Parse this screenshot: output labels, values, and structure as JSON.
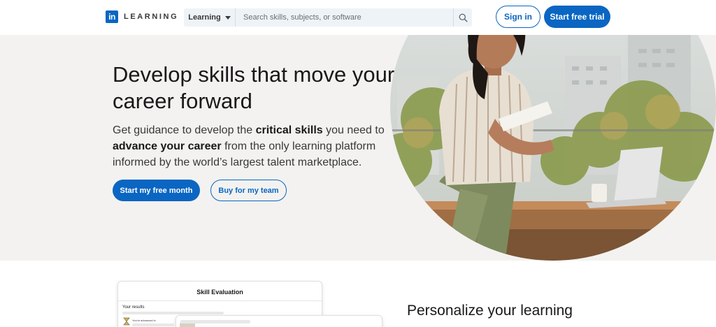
{
  "header": {
    "logo_text": "LEARNING",
    "search": {
      "type_label": "Learning",
      "placeholder": "Search skills, subjects, or software"
    },
    "signin_label": "Sign in",
    "trial_label": "Start free trial"
  },
  "hero": {
    "title": "Develop skills that move your career forward",
    "subtitle": {
      "part1": "Get guidance to develop the ",
      "bold1": "critical skills",
      "part2": " you need to ",
      "bold2": "advance your career",
      "part3": " from the only learning platform informed by the world’s largest talent marketplace."
    },
    "primary_button": "Start my free month",
    "secondary_button": "Buy for my team"
  },
  "skill_card": {
    "title": "Skill Evaluation",
    "results_label": "Your results",
    "advanced_label": "You're advanced in"
  },
  "personalize": {
    "title": "Personalize your learning"
  },
  "colors": {
    "brand": "#0a66c2",
    "hero_bg": "#f3f2f0",
    "search_bg": "#eef3f8"
  },
  "icons": {
    "logo": "linkedin-in-icon",
    "search": "search-icon",
    "caret": "caret-down-icon"
  }
}
